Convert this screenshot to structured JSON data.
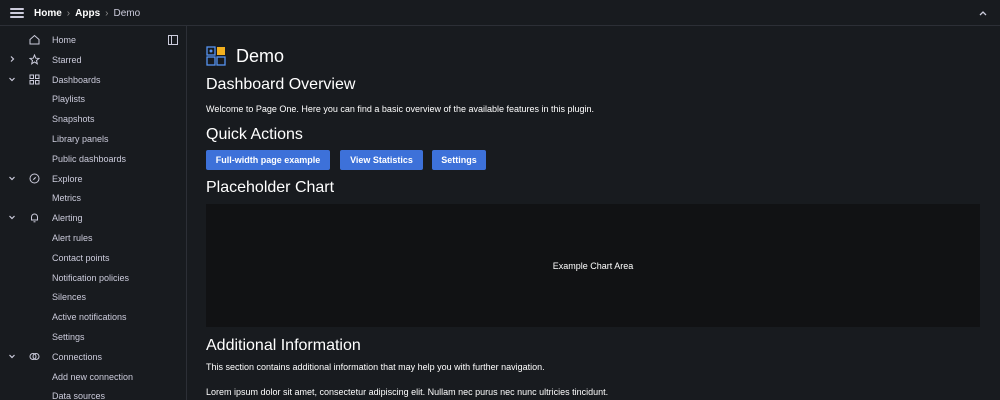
{
  "breadcrumb": {
    "home": "Home",
    "apps": "Apps",
    "current": "Demo"
  },
  "sidebar": {
    "items": [
      {
        "label": "Home",
        "icon": "home-icon",
        "chevron": ""
      },
      {
        "label": "Starred",
        "icon": "star-icon",
        "chevron": "right"
      },
      {
        "label": "Dashboards",
        "icon": "grid-icon",
        "chevron": "down"
      },
      {
        "label": "Playlists",
        "icon": "",
        "chevron": ""
      },
      {
        "label": "Snapshots",
        "icon": "",
        "chevron": ""
      },
      {
        "label": "Library panels",
        "icon": "",
        "chevron": ""
      },
      {
        "label": "Public dashboards",
        "icon": "",
        "chevron": ""
      },
      {
        "label": "Explore",
        "icon": "compass-icon",
        "chevron": "down"
      },
      {
        "label": "Metrics",
        "icon": "",
        "chevron": ""
      },
      {
        "label": "Alerting",
        "icon": "bell-icon",
        "chevron": "down"
      },
      {
        "label": "Alert rules",
        "icon": "",
        "chevron": ""
      },
      {
        "label": "Contact points",
        "icon": "",
        "chevron": ""
      },
      {
        "label": "Notification policies",
        "icon": "",
        "chevron": ""
      },
      {
        "label": "Silences",
        "icon": "",
        "chevron": ""
      },
      {
        "label": "Active notifications",
        "icon": "",
        "chevron": ""
      },
      {
        "label": "Settings",
        "icon": "",
        "chevron": ""
      },
      {
        "label": "Connections",
        "icon": "connections-icon",
        "chevron": "down"
      },
      {
        "label": "Add new connection",
        "icon": "",
        "chevron": ""
      },
      {
        "label": "Data sources",
        "icon": "",
        "chevron": ""
      }
    ]
  },
  "main": {
    "page_title": "Demo",
    "overview_heading": "Dashboard Overview",
    "welcome_text": "Welcome to Page One. Here you can find a basic overview of the available features in this plugin.",
    "quick_actions_heading": "Quick Actions",
    "buttons": {
      "full_width": "Full-width page example",
      "view_statistics": "View Statistics",
      "settings": "Settings"
    },
    "chart_heading": "Placeholder Chart",
    "chart_placeholder": "Example Chart Area",
    "additional_heading": "Additional Information",
    "additional_text": "This section contains additional information that may help you with further navigation.",
    "lorem_text": "Lorem ipsum dolor sit amet, consectetur adipiscing elit. Nullam nec purus nec nunc ultricies tincidunt."
  },
  "colors": {
    "accent": "#3d71d9",
    "background": "#181b1f",
    "chart_bg": "#111214"
  }
}
